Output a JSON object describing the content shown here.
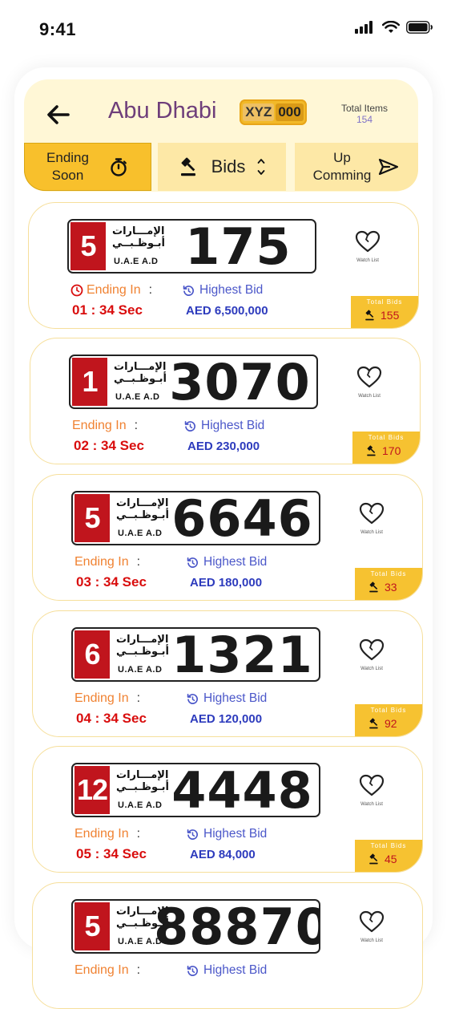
{
  "status_bar": {
    "time": "9:41"
  },
  "header": {
    "city": "Abu Dhabi",
    "logo": {
      "left": "XYZ",
      "right": "000"
    },
    "total_items_label": "Total Items",
    "total_items_value": "154"
  },
  "tabs": {
    "ending_soon": {
      "line1": "Ending",
      "line2": "Soon"
    },
    "bids": {
      "label": "Bids"
    },
    "upcoming": {
      "line1": "Up",
      "line2": "Comming"
    }
  },
  "labels": {
    "ending_in": "Ending In",
    "colon": ":",
    "highest_bid": "Highest Bid",
    "watch_list": "Watch List",
    "total_bids": "Total Bids",
    "plate_arabic_1": "الإمـــارات",
    "plate_arabic_2": "أبـوظـبــي",
    "plate_uae": "U.A.E A.D"
  },
  "colors": {
    "accent_yellow": "#f8c02c",
    "header_bg": "#fff7d6",
    "ending_orange": "#f08232",
    "timer_red": "#d90d0d",
    "bid_blue": "#2d3bbd",
    "plate_red": "#c0151d"
  },
  "listings": [
    {
      "code": "5",
      "number": "175",
      "time_left": "01 : 34 Sec",
      "highest_bid": "AED 6,500,000",
      "total_bids": "155"
    },
    {
      "code": "1",
      "number": "3070",
      "time_left": "02 : 34 Sec",
      "highest_bid": "AED 230,000",
      "total_bids": "170"
    },
    {
      "code": "5",
      "number": "6646",
      "time_left": "03 : 34 Sec",
      "highest_bid": "AED 180,000",
      "total_bids": "33"
    },
    {
      "code": "6",
      "number": "1321",
      "time_left": "04 : 34 Sec",
      "highest_bid": "AED 120,000",
      "total_bids": "92"
    },
    {
      "code": "12",
      "number": "4448",
      "time_left": "05 : 34 Sec",
      "highest_bid": "AED 84,000",
      "total_bids": "45"
    },
    {
      "code": "5",
      "number": "88870",
      "highest_bid_label_only": true
    }
  ]
}
